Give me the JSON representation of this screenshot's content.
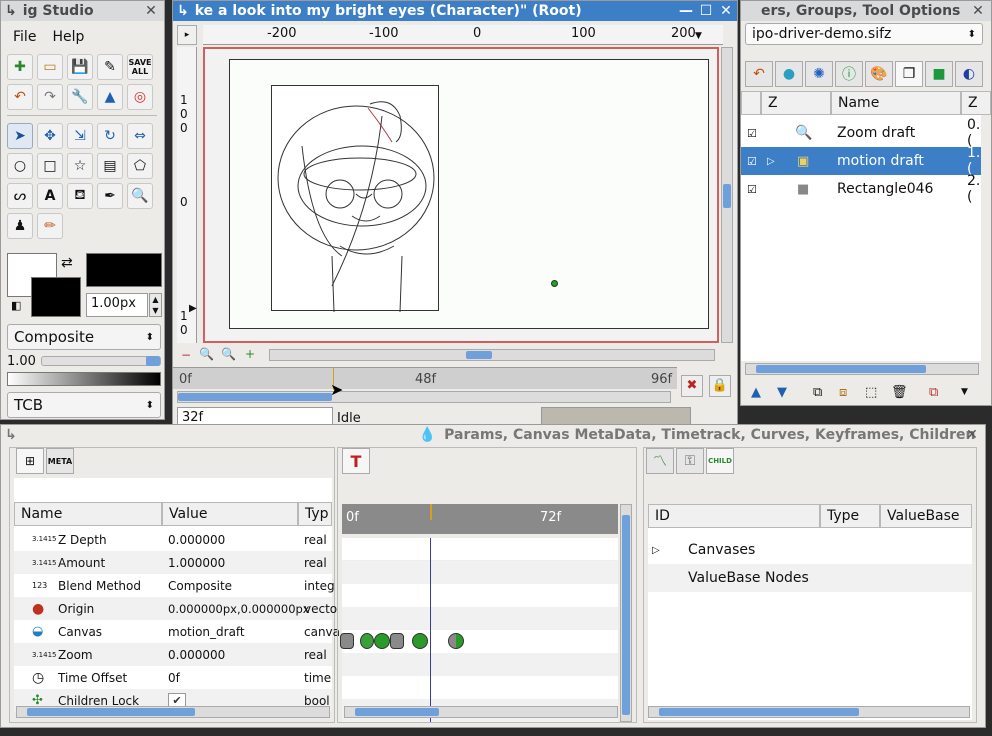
{
  "toolbox": {
    "title": "ig Studio",
    "menu": {
      "file": "File",
      "help": "Help"
    },
    "save_all": "SAVE ALL",
    "brush_size": "1.00px",
    "blend_method": "Composite",
    "opacity": "1.00",
    "interpolation": "TCB"
  },
  "canvas_window": {
    "title": "ke a look into my bright eyes (Character)\" (Root)",
    "ruler_labels": [
      "-200",
      "-100",
      "0",
      "100",
      "200"
    ],
    "vruler_labels": [
      "1",
      "0",
      "0",
      "0",
      "1",
      "0"
    ],
    "timebar_labels": [
      "0f",
      "48f",
      "96f"
    ],
    "current_frame": "32f",
    "status": "Idle"
  },
  "layers_panel": {
    "title": "ers, Groups, Tool Options",
    "file": "ipo-driver-demo.sifz",
    "columns": {
      "z": "Z",
      "name": "Name",
      "z2": "Z"
    },
    "layers": [
      {
        "name": "Zoom draft",
        "z": "0.(",
        "icon": "zoom-icon"
      },
      {
        "name": "motion draft",
        "z": "1.(",
        "icon": "group-icon"
      },
      {
        "name": "Rectangle046",
        "z": "2.(",
        "icon": "rectangle-icon"
      }
    ]
  },
  "bottom_panel": {
    "title": "Params, Canvas MetaData, Timetrack, Curves, Keyframes, Children",
    "meta_tab": "META",
    "child_tab": "CHILD",
    "params_columns": {
      "name": "Name",
      "value": "Value",
      "type": "Typ"
    },
    "params": [
      {
        "name": "Z Depth",
        "value": "0.000000",
        "type": "real"
      },
      {
        "name": "Amount",
        "value": "1.000000",
        "type": "real"
      },
      {
        "name": "Blend Method",
        "value": "Composite",
        "type": "integ"
      },
      {
        "name": "Origin",
        "value": "0.000000px,0.000000px",
        "type": "vecto"
      },
      {
        "name": "Canvas",
        "value": "motion_draft",
        "type": "canva"
      },
      {
        "name": "Zoom",
        "value": "0.000000",
        "type": "real"
      },
      {
        "name": "Time Offset",
        "value": "0f",
        "type": "time"
      },
      {
        "name": "Children Lock",
        "value": "",
        "type": "bool"
      }
    ],
    "timetrack_labels": [
      "0f",
      "72f"
    ],
    "children_columns": {
      "id": "ID",
      "type": "Type",
      "valuebase": "ValueBase"
    },
    "children": [
      "Canvases",
      "ValueBase Nodes"
    ]
  }
}
